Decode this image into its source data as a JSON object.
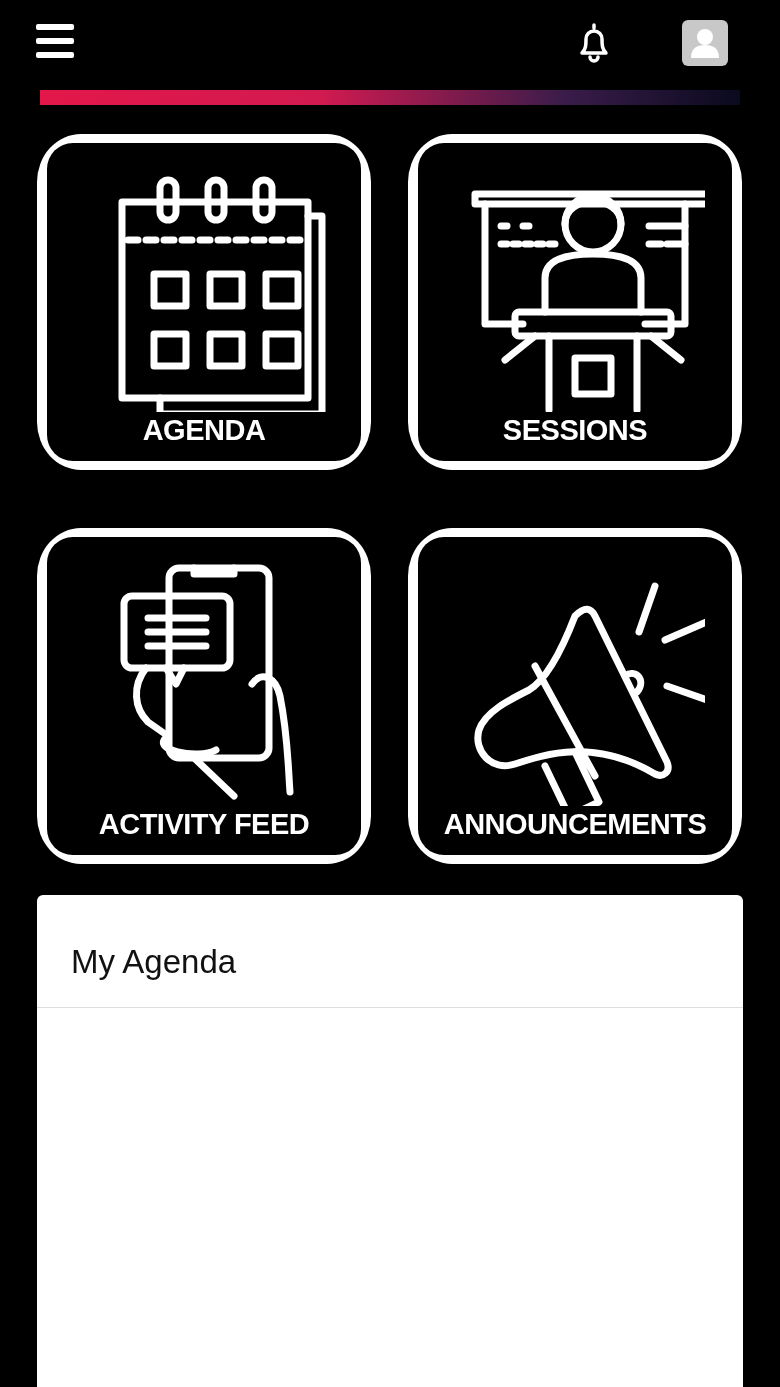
{
  "tiles": [
    {
      "label": "AGENDA",
      "kind": "calendar"
    },
    {
      "label": "SESSIONS",
      "kind": "presenter"
    },
    {
      "label": "ACTIVITY FEED",
      "kind": "phone"
    },
    {
      "label": "ANNOUNCEMENTS",
      "kind": "megaphone"
    }
  ],
  "agenda_card": {
    "title": "My Agenda"
  }
}
